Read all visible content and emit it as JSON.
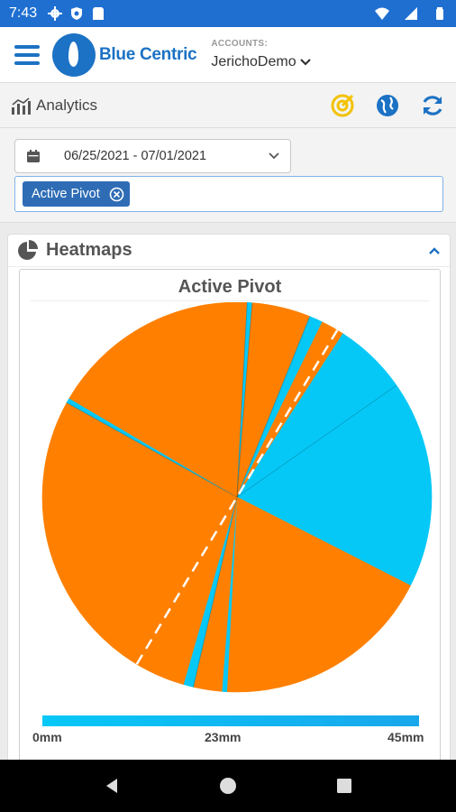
{
  "status_bar": {
    "time": "7:43"
  },
  "app_bar": {
    "brand": "Blue Centric",
    "accounts_label": "ACCOUNTS:",
    "account": "JerichoDemo"
  },
  "toolbar": {
    "title": "Analytics"
  },
  "filters": {
    "date_range": "06/25/2021 - 07/01/2021",
    "tags": [
      "Active Pivot"
    ]
  },
  "panel": {
    "title": "Heatmaps"
  },
  "chart_data": {
    "type": "pie",
    "title": "Active Pivot",
    "color_scale": {
      "min_label": "0mm",
      "mid_label": "23mm",
      "max_label": "45mm",
      "min_color": "#06c8f7",
      "max_color": "#ff8000"
    },
    "slices": [
      {
        "start_deg": 0,
        "end_deg": 3,
        "color": "#ff8000"
      },
      {
        "start_deg": 3,
        "end_deg": 4.5,
        "color": "#06c8f7"
      },
      {
        "start_deg": 4.5,
        "end_deg": 22,
        "color": "#ff8000"
      },
      {
        "start_deg": 22,
        "end_deg": 26,
        "color": "#06c8f7"
      },
      {
        "start_deg": 26,
        "end_deg": 33,
        "color": "#ff8000"
      },
      {
        "start_deg": 33,
        "end_deg": 117,
        "color": "#06c8f7"
      },
      {
        "start_deg": 117,
        "end_deg": 183,
        "color": "#ff8000"
      },
      {
        "start_deg": 183,
        "end_deg": 184.5,
        "color": "#06c8f7"
      },
      {
        "start_deg": 184.5,
        "end_deg": 193,
        "color": "#ff8000"
      },
      {
        "start_deg": 193,
        "end_deg": 196,
        "color": "#06c8f7"
      },
      {
        "start_deg": 196,
        "end_deg": 299,
        "color": "#ff8000"
      },
      {
        "start_deg": 299,
        "end_deg": 300.5,
        "color": "#06c8f7"
      },
      {
        "start_deg": 300.5,
        "end_deg": 360,
        "color": "#ff8000"
      }
    ]
  },
  "colors": {
    "brand_blue": "#1c72c4",
    "status_bar": "#1f6fd1",
    "tag_bg": "#2e6db5",
    "accent_yellow": "#f2c200"
  }
}
